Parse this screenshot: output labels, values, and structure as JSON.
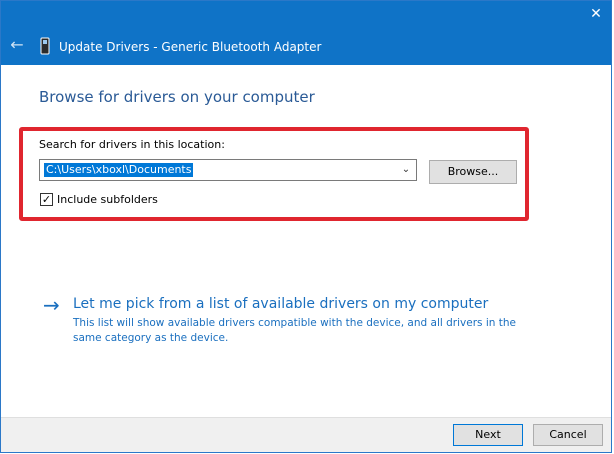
{
  "window": {
    "title": "Update Drivers - Generic Bluetooth Adapter",
    "close_glyph": "✕",
    "accent_color": "#0f73c7"
  },
  "nav": {
    "back_glyph": "←"
  },
  "main": {
    "heading": "Browse for drivers on your computer",
    "search_label": "Search for drivers in this location:",
    "path_value": "C:\\Users\\xboxl\\Documents",
    "combo_arrow_glyph": "⌄",
    "browse_label": "Browse...",
    "include_subfolders_label": "Include subfolders",
    "include_subfolders_checked": "✓",
    "highlight_color": "#e0262f"
  },
  "pick": {
    "arrow_glyph": "→",
    "link_text": "Let me pick from a list of available drivers on my computer",
    "description": "This list will show available drivers compatible with the device, and all drivers in the same category as the device."
  },
  "footer": {
    "next_label": "Next",
    "cancel_label": "Cancel"
  },
  "icons": {
    "device": "device-icon",
    "back": "back-arrow-icon",
    "close": "close-icon",
    "dropdown": "chevron-down-icon",
    "check": "checkmark-icon",
    "link_arrow": "arrow-right-icon"
  }
}
